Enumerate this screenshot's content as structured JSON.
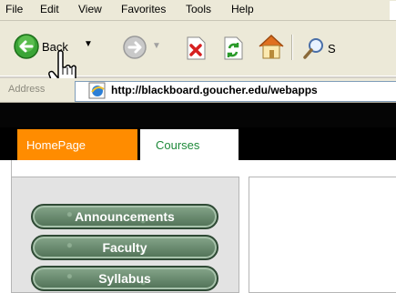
{
  "menu": {
    "items": [
      "File",
      "Edit",
      "View",
      "Favorites",
      "Tools",
      "Help"
    ]
  },
  "toolbar": {
    "back_label": "Back",
    "search_partial": "S"
  },
  "address": {
    "label": "Address",
    "url": "http://blackboard.goucher.edu/webapps"
  },
  "tabs": [
    {
      "label": "HomePage"
    },
    {
      "label": "Courses"
    }
  ],
  "nav": {
    "announcements": "Announcements",
    "faculty": "Faculty",
    "syllabus": "Syllabus"
  },
  "colors": {
    "active_tab": "#ff8c00",
    "courses_text": "#1e8a3a",
    "button_green": "#5c7e62"
  }
}
